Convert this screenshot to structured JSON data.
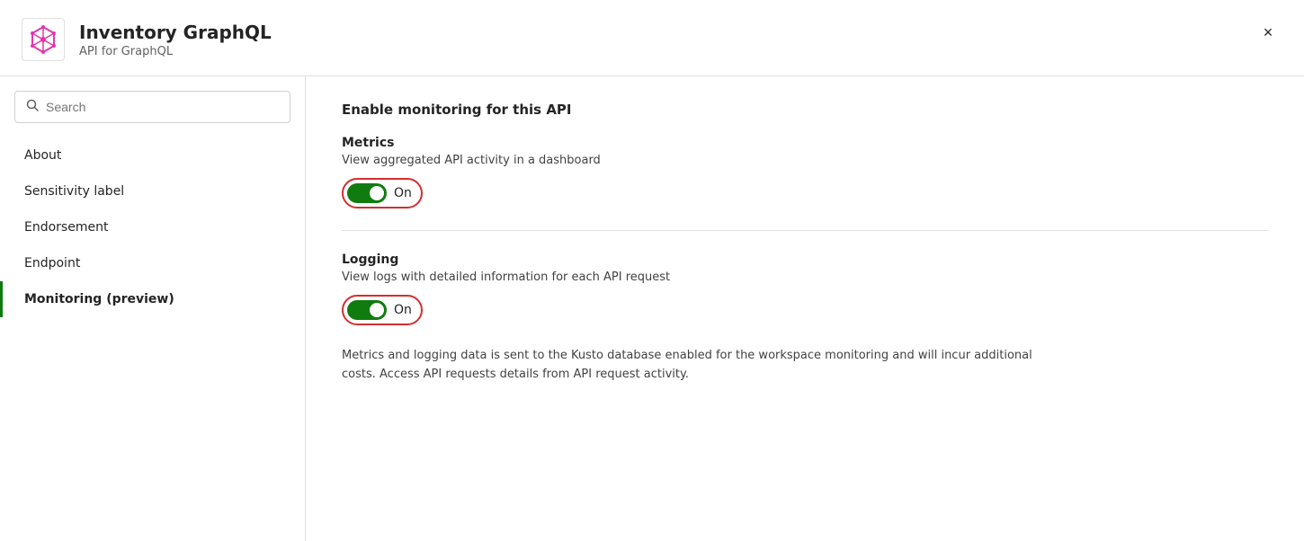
{
  "header": {
    "title": "Inventory GraphQL",
    "subtitle": "API for GraphQL",
    "close_label": "×"
  },
  "sidebar": {
    "search_placeholder": "Search",
    "nav_items": [
      {
        "id": "about",
        "label": "About",
        "active": false
      },
      {
        "id": "sensitivity-label",
        "label": "Sensitivity label",
        "active": false
      },
      {
        "id": "endorsement",
        "label": "Endorsement",
        "active": false
      },
      {
        "id": "endpoint",
        "label": "Endpoint",
        "active": false
      },
      {
        "id": "monitoring",
        "label": "Monitoring (preview)",
        "active": true
      }
    ]
  },
  "main": {
    "section_title": "Enable monitoring for this API",
    "metrics": {
      "label": "Metrics",
      "description": "View aggregated API activity in a dashboard",
      "toggle_text": "On",
      "toggle_on": true
    },
    "logging": {
      "label": "Logging",
      "description": "View logs with detailed information for each API request",
      "toggle_text": "On",
      "toggle_on": true
    },
    "footer_note": "Metrics and logging data is sent to the Kusto database enabled for the workspace monitoring and will incur additional costs. Access API requests details from API request activity."
  },
  "icons": {
    "search": "🔍",
    "graphql": "◈",
    "close": "✕"
  }
}
